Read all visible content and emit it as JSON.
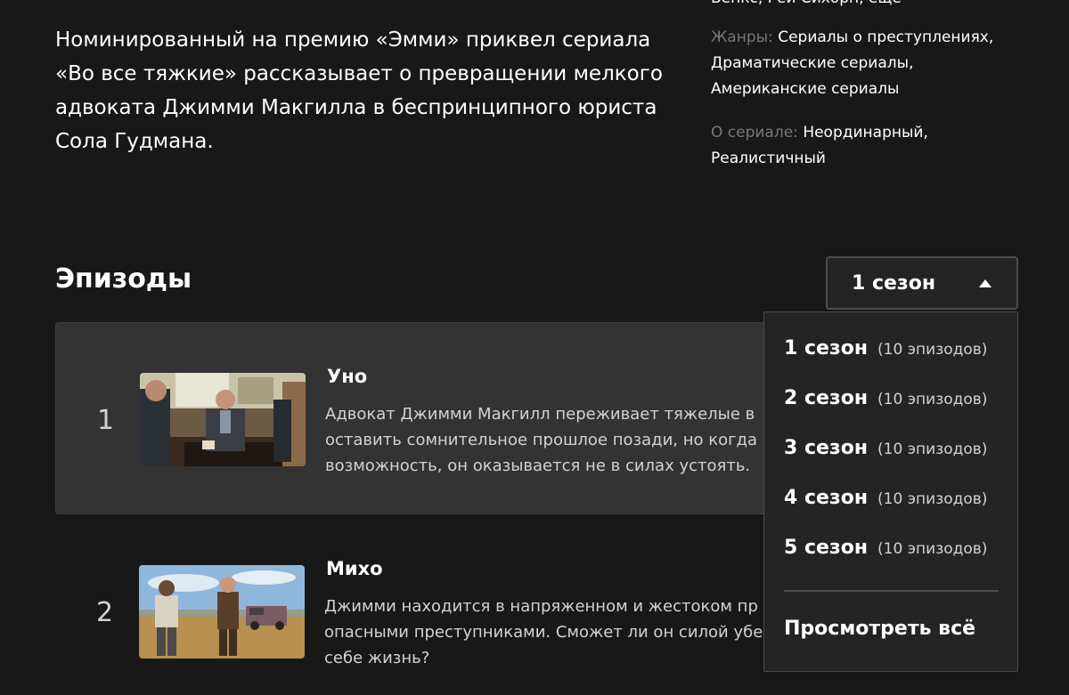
{
  "details": {
    "cast_cut": "Бенкс, Рей Сихорн, ещё",
    "synopsis": "Номинированный на премию «Эмми» приквел сериала «Во все тяжкие» рассказывает о превращении мелкого адвоката Джимми Макгилла в беспринципного юриста Сола Гудмана.",
    "genres_label": "Жанры:",
    "genres_value": "Сериалы о преступлениях, Драматические сериалы, Американские сериалы",
    "about_label": "О сериале:",
    "about_value": "Неординарный, Реалистичный"
  },
  "episodes": {
    "title": "Эпизоды",
    "selected_season": "1 сезон",
    "items": [
      {
        "number": "1",
        "title": "Уно",
        "description_lines": [
          "Адвокат Джимми Макгилл переживает тяжелые в",
          "оставить сомнительное прошлое позади, но когда",
          "возможность, он оказывается не в силах устоять."
        ]
      },
      {
        "number": "2",
        "title": "Михо",
        "description_lines": [
          "Джимми находится в напряженном и жестоком пр",
          "опасными преступниками. Сможет ли он силой убе",
          "себе жизнь?"
        ]
      }
    ]
  },
  "season_dropdown": {
    "options": [
      {
        "season": "1 сезон",
        "count": "(10 эпизодов)"
      },
      {
        "season": "2 сезон",
        "count": "(10 эпизодов)"
      },
      {
        "season": "3 сезон",
        "count": "(10 эпизодов)"
      },
      {
        "season": "4 сезон",
        "count": "(10 эпизодов)"
      },
      {
        "season": "5 сезон",
        "count": "(10 эпизодов)"
      }
    ],
    "see_all": "Просмотреть всё"
  },
  "icons": {
    "dropdown_caret": "caret-up-icon"
  }
}
